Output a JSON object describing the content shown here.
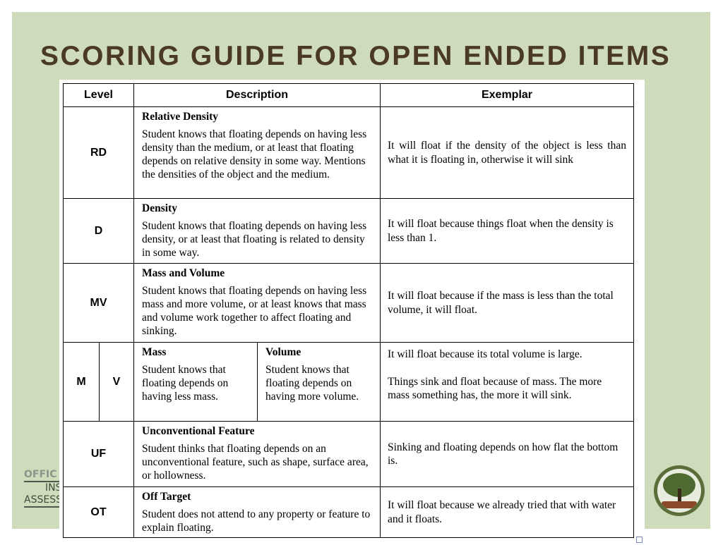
{
  "slide": {
    "title": "SCORING GUIDE FOR OPEN ENDED ITEMS",
    "background_color": "#cfdcbc",
    "title_color": "#4a3a24",
    "logo_text": [
      "OFFIC",
      "INSTI",
      "ASSESS"
    ],
    "seal_icon": "tree-seal-icon"
  },
  "table": {
    "headers": [
      "Level",
      "Description",
      "Exemplar"
    ],
    "rows": [
      {
        "level": "RD",
        "title": "Relative Density",
        "description": "Student knows that floating depends on having less density than the medium, or at least that floating depends on relative density in some way. Mentions the densities of the object and the medium.",
        "exemplar": "It will float if the density of the object is less than what it is floating in, otherwise it will sink"
      },
      {
        "level": "D",
        "title": "Density",
        "description": "Student knows that floating depends on having less density, or at least that floating is related to density in some way.",
        "exemplar": "It will float because things float when the density is less than 1."
      },
      {
        "level": "MV",
        "title": "Mass and Volume",
        "description": "Student knows that floating depends on having less mass and more volume, or at least knows that mass and volume work together to affect floating and sinking.",
        "exemplar": "It will float because if the mass is less than the total volume, it will float."
      },
      {
        "level_m": "M",
        "level_v": "V",
        "title_m": "Mass",
        "description_m": "Student knows that floating depends on having less mass.",
        "title_v": "Volume",
        "description_v": "Student knows that floating depends on having more volume.",
        "exemplar_v": "It will float because its total volume is large.",
        "exemplar_m": "Things sink and float because of mass. The more mass something has, the more it will sink."
      },
      {
        "level": "UF",
        "title": "Unconventional Feature",
        "description": "Student thinks that floating depends on an unconventional feature, such as shape, surface area, or hollowness.",
        "exemplar": "Sinking and floating depends on how flat the bottom is."
      },
      {
        "level": "OT",
        "title": "Off Target",
        "description": "Student does not attend to any property or feature to explain floating.",
        "exemplar": "It will float because we already tried that with water and it floats."
      }
    ]
  }
}
